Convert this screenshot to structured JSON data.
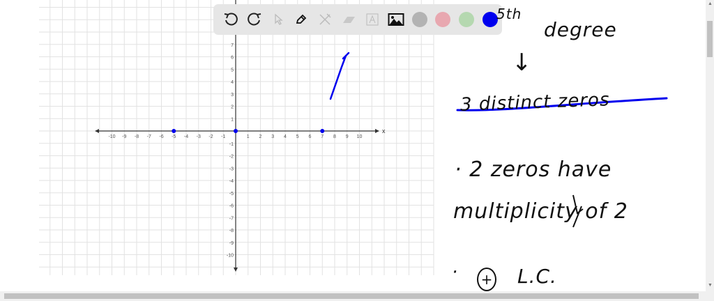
{
  "toolbar": {
    "tools": [
      {
        "icon": "undo-icon",
        "enabled": true
      },
      {
        "icon": "redo-icon",
        "enabled": true
      },
      {
        "icon": "pointer-icon",
        "enabled": false
      },
      {
        "icon": "pen-icon",
        "enabled": true
      },
      {
        "icon": "tools-icon",
        "enabled": false
      },
      {
        "icon": "eraser-icon",
        "enabled": false
      },
      {
        "icon": "text-box-icon",
        "enabled": false
      },
      {
        "icon": "image-icon",
        "enabled": true
      }
    ],
    "colors": [
      {
        "name": "gray",
        "hex": "#b3b3b3"
      },
      {
        "name": "pink",
        "hex": "#e8a8b0"
      },
      {
        "name": "green",
        "hex": "#b5d8b0"
      },
      {
        "name": "blue",
        "hex": "#0000ee"
      }
    ]
  },
  "graph": {
    "x_min": -10,
    "x_max": 10,
    "y_min": -10,
    "y_max": 7,
    "x_axis_label": "x",
    "zero_points": [
      -5,
      0,
      7
    ],
    "point_color": "#0000ee"
  },
  "notes": {
    "line1": "5th",
    "line1b": "degree",
    "arrow": "↓",
    "struck": "3 distinct zeros",
    "bullet1a": "· 2 zeros have",
    "bullet1b": "multiplicity of 2",
    "bullet2_circled": "+",
    "bullet2": "L.C."
  }
}
